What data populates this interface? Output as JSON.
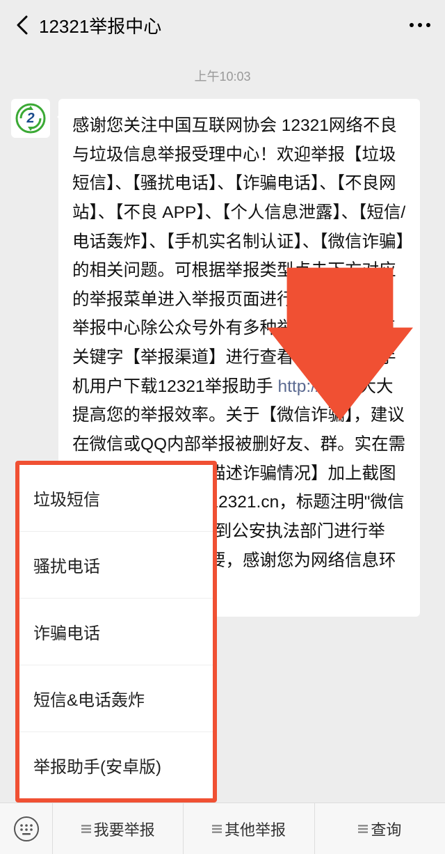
{
  "header": {
    "title": "12321举报中心"
  },
  "timestamp": "上午10:03",
  "message": {
    "text_part1": "感谢您关注中国互联网协会 12321网络不良与垃圾信息举报受理中心！欢迎举报【垃圾短信】、【骚扰电话】、【诈骗电话】、【不良网站】、【不良 APP】、【个人信息泄露】、【短信/电话轰炸】、【手机实名制认证】、【微信诈骗】的相关问题。可根据举报类型点击下方对应的举报菜单进入举报页面进行举报。12321举报中心除公众号外有多种举报渠道，回复关键字【举报渠道】进行查看。推荐安卓手机用户下载12321举报助手",
    "link_text": "http://",
    "text_part2": "，将大大提高您的举报效率。关于【微信诈骗】，建议在微信或QQ内部举报被删好友、群。实在需要举报的请【详细描述诈骗情况】加上截图发邮件到 abuse@12321.cn，标题注明\"微信诈骗\"。损失钱财请到公安执法部门进行举报。您的举报很重要，感谢您为网络信息环境所做的贡"
  },
  "popup": {
    "items": [
      "垃圾短信",
      "骚扰电话",
      "诈骗电话",
      "短信&电话轰炸",
      "举报助手(安卓版)"
    ]
  },
  "bottom": {
    "tab1": "我要举报",
    "tab2": "其他举报",
    "tab3": "查询"
  }
}
